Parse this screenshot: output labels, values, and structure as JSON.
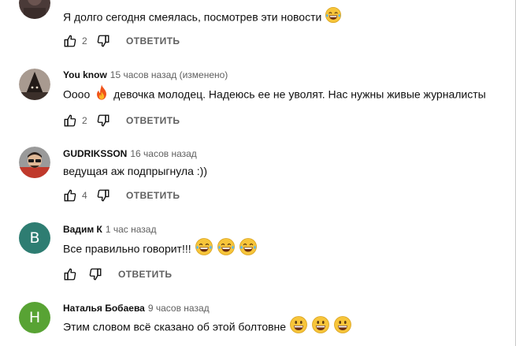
{
  "reply_label": "ОТВЕТИТЬ",
  "comments": [
    {
      "author": "",
      "time": "",
      "text": "Я долго сегодня смеялась, посмотрев эти новости",
      "likes": "2",
      "avatar_color": "#4a3a38"
    },
    {
      "author": "You know",
      "time": "15 часов назад (изменено)",
      "text_a": "Оооо",
      "text_b": "девочка молодец. Надеюсь ее не уволят. Нас нужны живые журналисты",
      "likes": "2",
      "avatar_color": "#6b5a52"
    },
    {
      "author": "GUDRIKSSON",
      "time": "16 часов назад",
      "text": "ведущая аж подпрыгнула :))",
      "likes": "4",
      "avatar_color": "#8a8a8a"
    },
    {
      "author": "Вадим К",
      "time": "1 час назад",
      "text": "Все правильно говорит!!!",
      "likes": "",
      "avatar_letter": "В",
      "avatar_color": "#2e7d72"
    },
    {
      "author": "Наталья Бобаева",
      "time": "9 часов назад",
      "text": "Этим словом всё сказано об этой болтовне",
      "likes": "",
      "avatar_letter": "Н",
      "avatar_color": "#58a334"
    }
  ],
  "icons": [
    "thumbs-up-icon",
    "thumbs-down-icon",
    "laughing-face-icon",
    "fire-icon",
    "grinning-face-icon"
  ]
}
